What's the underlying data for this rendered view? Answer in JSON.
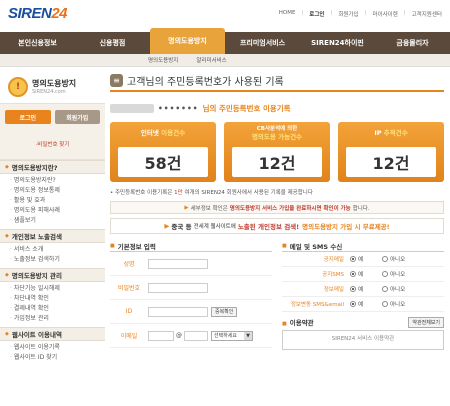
{
  "header": {
    "logo_main": "SIREN",
    "logo_num": "24",
    "links": [
      "HOME",
      "로그인",
      "회원가입",
      "마이사이렌",
      "고객지원센터"
    ]
  },
  "nav": {
    "items": [
      "본인신용정보",
      "신용평점",
      "명의도용방지",
      "프리미엄서비스",
      "SIREN24하이핀",
      "금융몰리자"
    ],
    "active_index": 2,
    "sub": [
      "명의도용방지",
      "알리미서비스"
    ]
  },
  "sidebar": {
    "title": "명의도용방지",
    "subtitle": "SIREN24.com",
    "login_label": "로그인",
    "join_label": "회원가입",
    "note": "·비밀번호 찾기",
    "sections": [
      {
        "title": "명의도용방지란?",
        "items": [
          "명의도용방지란?",
          "명의도용 정보통제",
          "활용 및 효과",
          "명의도용 피해사례",
          "샘플보기"
        ]
      },
      {
        "title": "개인정보 노출검색",
        "items": [
          "서비스 소개",
          "노출정보 검색하기"
        ]
      },
      {
        "title": "명의도용방지 관리",
        "items": [
          "차단기능 일시해제",
          "차단내역 확인",
          "결제내역 확인",
          "가입정보 관리"
        ]
      },
      {
        "title": "웹사이트 이용내역",
        "items": [
          "웹사이트 이용기록",
          "웹사이트 ID 찾기"
        ]
      }
    ]
  },
  "main": {
    "title": "고객님의 주민등록번호가 사용된 기록",
    "record_dots": "•••••••",
    "record_label": "님의 주민등록번호 이용기록",
    "stats": [
      {
        "label_a": "인터넷",
        "label_hl": "이용건수",
        "value": "58건"
      },
      {
        "label_a": "CB사분석에 의한",
        "label_hl": "명의도용 가능건수",
        "value": "12건"
      },
      {
        "label_a": "IP",
        "label_hl": "추적건수",
        "value": "12건"
      }
    ],
    "info_pre": "주민등록번호 이용기록은",
    "info_red": "1만",
    "info_post": "여개의 SIREN24 회원사에서 사용된 기록을 제공합니다",
    "notice1_pre": "세부정보 확인은",
    "notice1_red": "명의도용방지 서비스 가입을 완료하시면 확인이 가능",
    "notice1_post": "합니다.",
    "notice2_a": "중국 등",
    "notice2_sm": "전세계 웹사이트에",
    "notice2_red": "노출된 개인정보 검색!",
    "notice2_org": "명의도용방지 가입 시 무료제공!"
  },
  "form_basic": {
    "title": "기본정보 입력",
    "rows": [
      {
        "label": "성명"
      },
      {
        "label": "비밀번호"
      },
      {
        "label": "ID",
        "button": "중복확인"
      },
      {
        "label": "이메일",
        "at": "@",
        "select": "선택하세요"
      }
    ]
  },
  "form_sms": {
    "title": "메일 및 SMS 수신",
    "rows": [
      {
        "label": "공지메일",
        "yes": "예",
        "no": "아니오"
      },
      {
        "label": "공지SMS",
        "yes": "예",
        "no": "아니오"
      },
      {
        "label": "정보메일",
        "yes": "예",
        "no": "아니오"
      },
      {
        "label": "정보변동 SMS&email",
        "yes": "예",
        "no": "아니오"
      }
    ],
    "agree_title": "이용약관",
    "agree_btn": "약관전체보기",
    "agree_text": "SIREN24 서비스 이용약관"
  }
}
